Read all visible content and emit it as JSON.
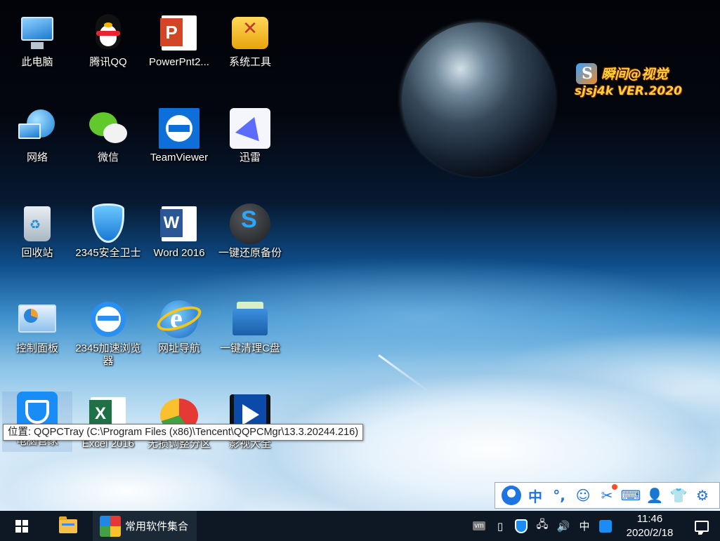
{
  "desktop": {
    "icons": [
      {
        "label": "此电脑"
      },
      {
        "label": "腾讯QQ"
      },
      {
        "label": "PowerPnt2..."
      },
      {
        "label": "系统工具"
      },
      {
        "label": "网络"
      },
      {
        "label": "微信"
      },
      {
        "label": "TeamViewer"
      },
      {
        "label": "迅雷"
      },
      {
        "label": "回收站"
      },
      {
        "label": "2345安全卫士"
      },
      {
        "label": "Word 2016"
      },
      {
        "label": "一键还原备份"
      },
      {
        "label": "控制面板"
      },
      {
        "label": "2345加速浏览器"
      },
      {
        "label": "网址导航"
      },
      {
        "label": "一键清理C盘"
      },
      {
        "label": "电脑管家"
      },
      {
        "label": "Excel 2016"
      },
      {
        "label": "无损调整分区"
      },
      {
        "label": "影视大全"
      }
    ],
    "watermark": {
      "line1": "瞬间@视觉",
      "line2": "sjsj4k VER.2020"
    },
    "tooltip": "位置: QQPCTray (C:\\Program Files (x86)\\Tencent\\QQPCMgr\\13.3.20244.216)"
  },
  "ime_toolbar": {
    "mode_label": "中",
    "items": [
      "sogou-logo",
      "chinese-mode",
      "punctuation",
      "emoji",
      "scissors",
      "keyboard",
      "user",
      "skin",
      "settings"
    ]
  },
  "taskbar": {
    "app_label": "常用软件集合",
    "tray_ime_label": "中",
    "vm_label": "vm",
    "clock_time": "11:46",
    "clock_date": "2020/2/18"
  }
}
